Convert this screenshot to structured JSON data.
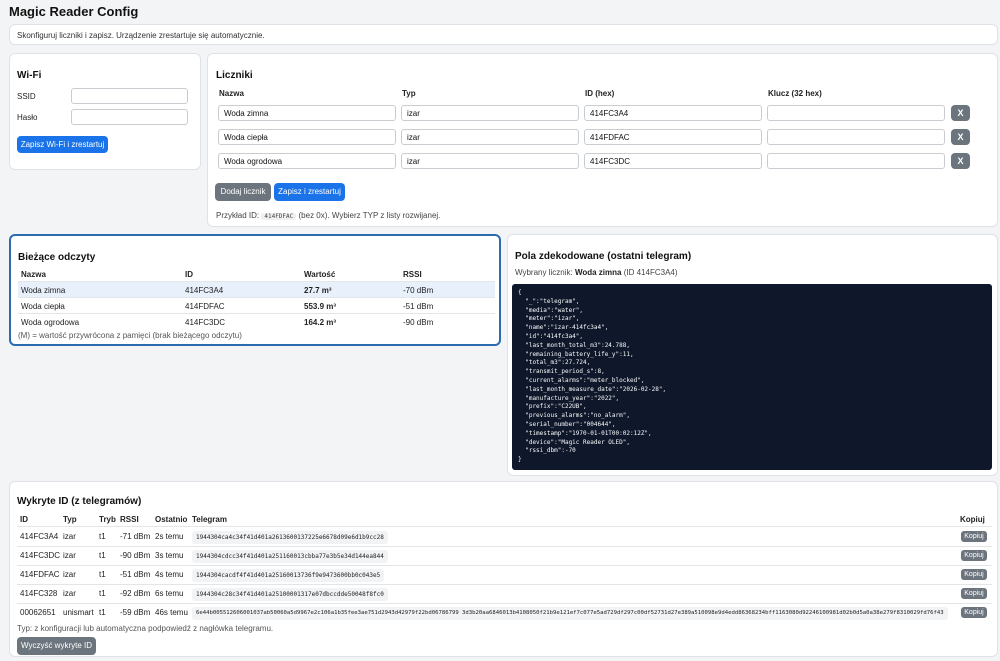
{
  "app_title": "Magic Reader Config",
  "intro": "Skonfiguruj liczniki i zapisz. Urządzenie zrestartuje się automatycznie.",
  "wifi": {
    "title": "Wi-Fi",
    "ssid_label": "SSID",
    "ssid_value": "",
    "password_label": "Hasło",
    "password_value": "",
    "save_label": "Zapisz Wi-Fi i zrestartuj"
  },
  "meters": {
    "title": "Liczniki",
    "headers": {
      "name": "Nazwa",
      "type": "Typ",
      "id": "ID (hex)",
      "key": "Klucz (32 hex)"
    },
    "rows": [
      {
        "name": "Woda zimna",
        "type": "izar",
        "id": "414FC3A4",
        "key": ""
      },
      {
        "name": "Woda ciepła",
        "type": "izar",
        "id": "414FDFAC",
        "key": ""
      },
      {
        "name": "Woda ogrodowa",
        "type": "izar",
        "id": "414FC3DC",
        "key": ""
      }
    ],
    "remove_label": "X",
    "add_label": "Dodaj licznik",
    "save_label": "Zapisz i zrestartuj",
    "hint_prefix": "Przykład ID:",
    "hint_code": "414FDFAC",
    "hint_suffix": "(bez 0x). Wybierz TYP z listy rozwijanej."
  },
  "readings": {
    "title": "Bieżące odczyty",
    "headers": {
      "name": "Nazwa",
      "id": "ID",
      "value": "Wartość",
      "rssi": "RSSI"
    },
    "rows": [
      {
        "name": "Woda zimna",
        "id": "414FC3A4",
        "value": "27.7 m³",
        "rssi": "-70 dBm"
      },
      {
        "name": "Woda ciepła",
        "id": "414FDFAC",
        "value": "553.9 m³",
        "rssi": "-51 dBm"
      },
      {
        "name": "Woda ogrodowa",
        "id": "414FC3DC",
        "value": "164.2 m³",
        "rssi": "-90 dBm"
      }
    ],
    "note": "(M) = wartość przywrócona z pamięci (brak bieżącego odczytu)"
  },
  "decoded": {
    "title": "Pola zdekodowane (ostatni telegram)",
    "selected_prefix": "Wybrany licznik:",
    "selected_name": "Woda zimna",
    "selected_id": "(ID 414FC3A4)",
    "json_text": "{\n  \"_\":\"telegram\",\n  \"media\":\"water\",\n  \"meter\":\"izar\",\n  \"name\":\"izar-414fc3a4\",\n  \"id\":\"414fc3a4\",\n  \"last_month_total_m3\":24.788,\n  \"remaining_battery_life_y\":11,\n  \"total_m3\":27.724,\n  \"transmit_period_s\":8,\n  \"current_alarms\":\"meter_blocked\",\n  \"last_month_measure_date\":\"2026-02-28\",\n  \"manufacture_year\":\"2022\",\n  \"prefix\":\"C22UB\",\n  \"previous_alarms\":\"no_alarm\",\n  \"serial_number\":\"004644\",\n  \"timestamp\":\"1970-01-01T00:02:12Z\",\n  \"device\":\"Magic Reader OLED\",\n  \"rssi_dbm\":-70\n}"
  },
  "detected": {
    "title": "Wykryte ID (z telegramów)",
    "headers": {
      "id": "ID",
      "type": "Typ",
      "mode": "Tryb",
      "rssi": "RSSI",
      "last": "Ostatnio",
      "telegram": "Telegram",
      "copy": "Kopiuj"
    },
    "rows": [
      {
        "id": "414FC3A4",
        "type": "izar",
        "mode": "t1",
        "rssi": "-71 dBm",
        "last": "2s temu",
        "telegram": "1944304ca4c34f41d401a2613600137225e6678d09e6d1b9cc28"
      },
      {
        "id": "414FC3DC",
        "type": "izar",
        "mode": "t1",
        "rssi": "-90 dBm",
        "last": "3s temu",
        "telegram": "1944304cdcc34f41d401a251160013cbba77e3b5e34d144ea844"
      },
      {
        "id": "414FDFAC",
        "type": "izar",
        "mode": "t1",
        "rssi": "-51 dBm",
        "last": "4s temu",
        "telegram": "1944304cacdf4f41d401a25160013736f9e9473600bb0c043e5"
      },
      {
        "id": "414FC328",
        "type": "izar",
        "mode": "t1",
        "rssi": "-92 dBm",
        "last": "6s temu",
        "telegram": "1944304c28c34f41d401a25100001317e07dbccdde50048f8fc0"
      },
      {
        "id": "00062651",
        "type": "unismart",
        "mode": "t1",
        "rssi": "-59 dBm",
        "last": "46s temu",
        "telegram": "6e44b005512606001037ab50060a5d9967e2c106a1b35fee3ae751d2943d42979f22bd06786799 3d3b20aa6846013b4108050f21b9e121ef7c077e5ad729df297c00df52731d27e389a510098e9d4edd86368234bff1163080d92246100981d02b0d5a0a38e279f8310029fd76f43"
      }
    ],
    "copy_label": "Kopiuj",
    "note": "Typ: z konfiguracji lub automatyczna podpowiedź z nagłówka telegramu.",
    "clear_label": "Wyczyść wykryte ID"
  }
}
